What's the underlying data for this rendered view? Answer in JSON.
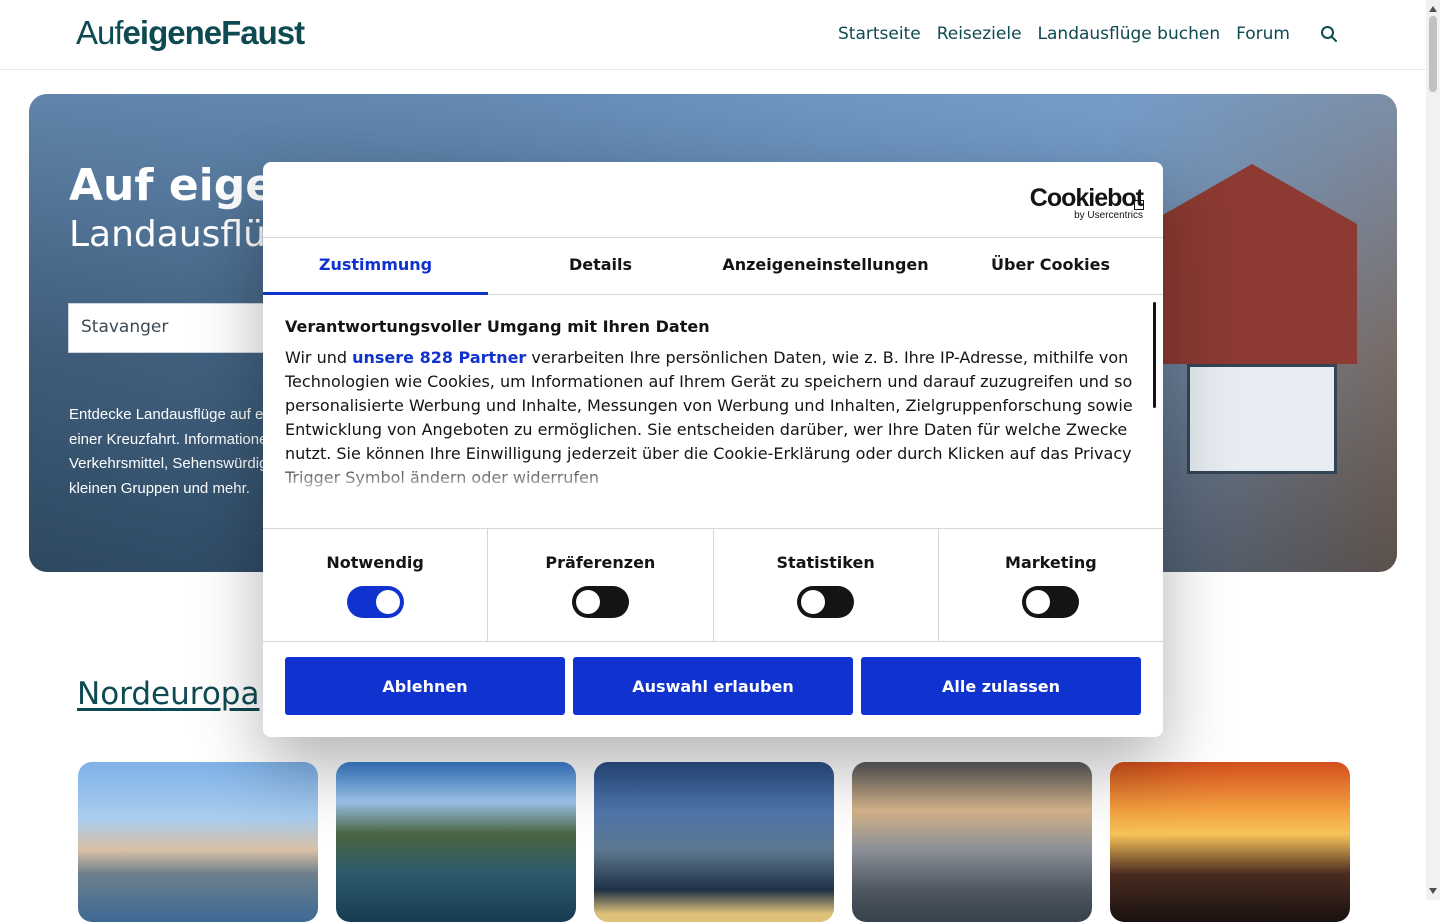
{
  "header": {
    "logo": {
      "part1": "Auf",
      "part2": "eigene",
      "part3": "Faust"
    },
    "nav": [
      "Startseite",
      "Reiseziele",
      "Landausflüge buchen",
      "Forum"
    ]
  },
  "hero": {
    "title": "Auf eigener Faust",
    "subtitle": "Landausflüge",
    "search_value": "Stavanger",
    "description_lines": [
      "Entdecke Landausflüge auf eigene Faust bei",
      "einer Kreuzfahrt. Informationen zu",
      "Verkehrsmittel, Sehenswürdigkeiten, Touren in",
      "kleinen Gruppen und mehr."
    ]
  },
  "section": {
    "title": "Nordeuropa"
  },
  "dialog": {
    "logo_main": "Cookiebot",
    "logo_by": "by Usercentrics",
    "tabs": [
      "Zustimmung",
      "Details",
      "Anzeigeneinstellungen",
      "Über Cookies"
    ],
    "heading": "Verantwortungsvoller Umgang mit Ihren Daten",
    "text_before": "Wir und ",
    "partner_link": "unsere 828 Partner",
    "text_after": " verarbeiten Ihre persönlichen Daten, wie z. B. Ihre IP-Adresse, mithilfe von Technologien wie Cookies, um Informationen auf Ihrem Gerät zu speichern und darauf zuzugreifen und so personalisierte Werbung und Inhalte, Messungen von Werbung und Inhalten, Zielgruppenforschung sowie Entwicklung von Angeboten zu ermöglichen. Sie entscheiden darüber, wer Ihre Daten für welche Zwecke nutzt. Sie können Ihre Einwilligung jederzeit über die Cookie-Erklärung oder durch Klicken auf das Privacy Trigger Symbol ändern oder widerrufen",
    "toggles": [
      {
        "label": "Notwendig",
        "on": true
      },
      {
        "label": "Präferenzen",
        "on": false
      },
      {
        "label": "Statistiken",
        "on": false
      },
      {
        "label": "Marketing",
        "on": false
      }
    ],
    "buttons": {
      "reject": "Ablehnen",
      "allow_selection": "Auswahl erlauben",
      "allow_all": "Alle zulassen"
    }
  },
  "colors": {
    "brand": "#0e4a52",
    "accent": "#1032cf"
  }
}
